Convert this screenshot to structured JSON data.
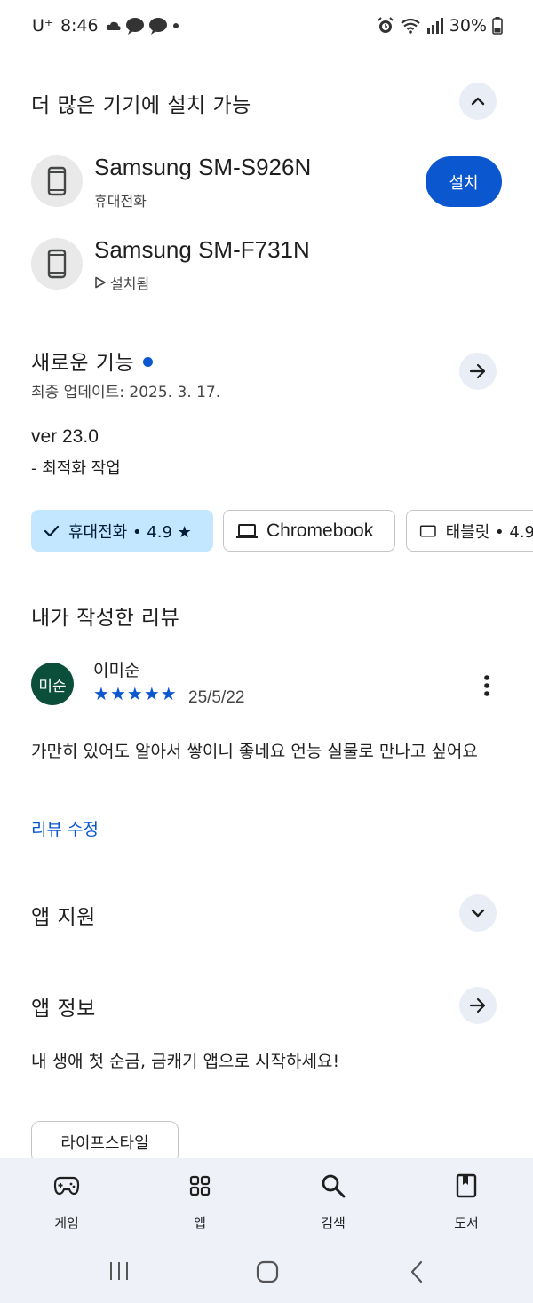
{
  "status_bar": {
    "carrier": "U⁺",
    "time": "8:46",
    "battery": "30%"
  },
  "available_devices": {
    "title": "더 많은 기기에 설치 가능",
    "devices": [
      {
        "name": "Samsung SM-S926N",
        "type": "휴대전화",
        "action": "설치"
      },
      {
        "name": "Samsung SM-F731N",
        "status": "설치됨"
      }
    ]
  },
  "whats_new": {
    "title": "새로운 기능",
    "updated": "최종 업데이트: 2025. 3. 17.",
    "version": "ver 23.0",
    "notes": "- 최적화 작업"
  },
  "rating_chips": [
    {
      "label": "휴대전화 • 4.9 ★",
      "selected": true
    },
    {
      "label": "Chromebook",
      "selected": false
    },
    {
      "label": "태블릿 • 4.9",
      "selected": false
    }
  ],
  "my_review": {
    "title": "내가 작성한 리뷰",
    "avatar_text": "미순",
    "author": "이미순",
    "rating": 5,
    "date": "25/5/22",
    "body": "가만히 있어도 알아서 쌓이니 좋네요 언능 실물로 만나고 싶어요",
    "edit_link": "리뷰 수정"
  },
  "app_support": {
    "title": "앱 지원"
  },
  "app_info": {
    "title": "앱 정보",
    "description": "내 생애 첫 순금, 금캐기 앱으로 시작하세요!",
    "category_tag": "라이프스타일"
  },
  "bottom_nav": {
    "items": [
      {
        "label": "게임",
        "icon": "gamepad-icon"
      },
      {
        "label": "앱",
        "icon": "apps-grid-icon"
      },
      {
        "label": "검색",
        "icon": "search-icon"
      },
      {
        "label": "도서",
        "icon": "book-icon"
      }
    ]
  },
  "colors": {
    "accent": "#0b57d0",
    "chip_selected": "#c2e7ff",
    "round_button": "#e9eef6",
    "nav_background": "#eef1f8",
    "avatar": "#0b4f3a"
  }
}
